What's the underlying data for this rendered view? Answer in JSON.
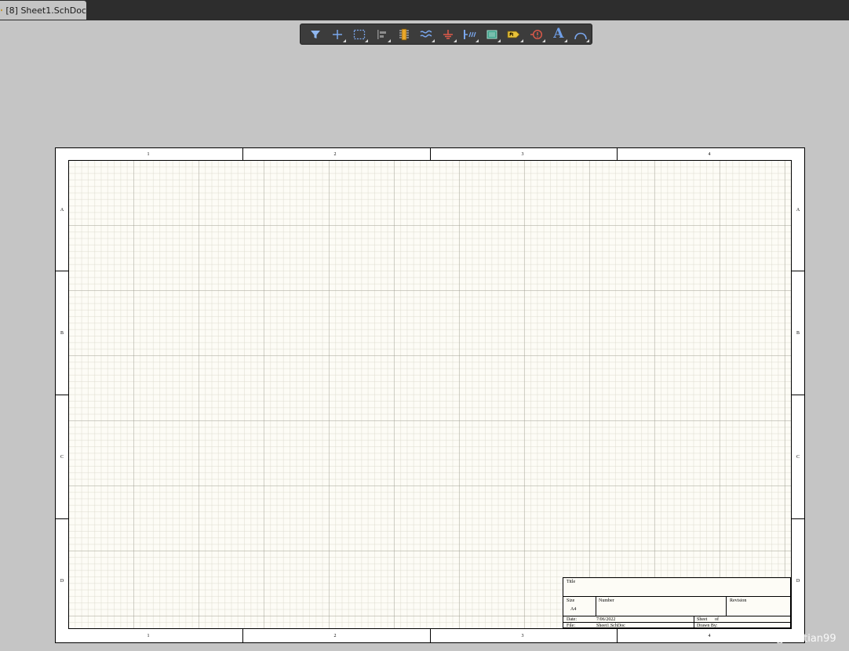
{
  "tab": {
    "label": "[8] Sheet1.SchDoc"
  },
  "toolbar": {
    "tools": [
      {
        "icon": "filter-icon"
      },
      {
        "icon": "crosshair-move-icon"
      },
      {
        "icon": "rectangle-select-icon"
      },
      {
        "icon": "align-icon"
      },
      {
        "icon": "component-icon"
      },
      {
        "icon": "wire-icon"
      },
      {
        "icon": "ground-power-icon"
      },
      {
        "icon": "bus-entry-icon"
      },
      {
        "icon": "harness-icon"
      },
      {
        "icon": "net-label-icon"
      },
      {
        "icon": "no-erc-icon"
      },
      {
        "icon": "text-icon",
        "glyph": "A"
      },
      {
        "icon": "arc-icon"
      }
    ]
  },
  "sheet": {
    "columns": [
      "1",
      "2",
      "3",
      "4"
    ],
    "rows": [
      "A",
      "B",
      "C",
      "D"
    ]
  },
  "title_block": {
    "title_label": "Title",
    "size_label": "Size",
    "size_value": "A4",
    "number_label": "Number",
    "revision_label": "Revision",
    "date_label": "Date:",
    "date_value": "7/06/2022",
    "sheet_label": "Sheet",
    "of_label": "of",
    "file_label": "File:",
    "file_value": "Sheet1.SchDoc",
    "drawn_by_label": "Drawn By:"
  },
  "watermark": "CSDN @xuetian99",
  "colors": {
    "background": "#c5c5c5",
    "toolbar": "#3c3c3c",
    "sheet": "#fdfcf6",
    "accent_blue": "#6f9fe8"
  }
}
